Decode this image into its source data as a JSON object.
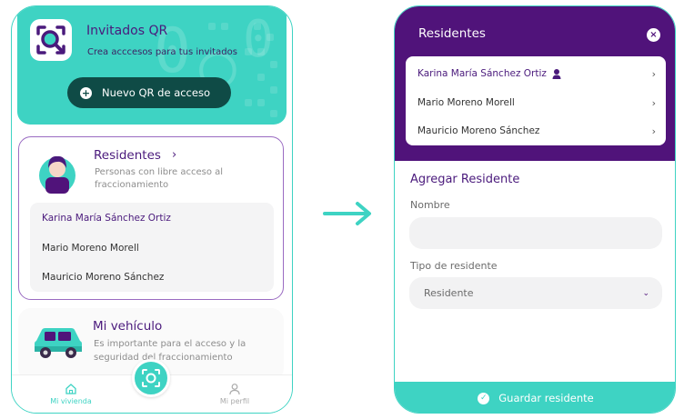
{
  "left_screen": {
    "qr_card": {
      "title": "Invitados QR",
      "subtitle": "Crea acccesos para tus invitados",
      "button_label": "Nuevo QR de acceso",
      "button_icon": "plus-circle-icon"
    },
    "residents_card": {
      "title": "Residentes",
      "title_chevron": "›",
      "description": "Personas con libre acceso al fraccionamiento",
      "list": [
        {
          "name": "Karina María Sánchez Ortiz"
        },
        {
          "name": "Mario Moreno Morell"
        },
        {
          "name": "Mauricio Moreno Sánchez"
        }
      ]
    },
    "vehicle_card": {
      "title": "Mi vehículo",
      "description": "Es importante para el acceso y la seguridad del fraccionamiento"
    },
    "bottom_nav": {
      "home_label": "Mi vivienda",
      "profile_label": "Mi perfil",
      "fab_icon": "qr-scan-icon"
    }
  },
  "right_screen": {
    "header": {
      "title": "Residentes",
      "close_glyph": "×"
    },
    "list": [
      {
        "name": "Karina María Sánchez Ortiz",
        "chevron": "›"
      },
      {
        "name": "Mario Moreno Morell",
        "chevron": "›"
      },
      {
        "name": "Mauricio Moreno Sánchez",
        "chevron": "›"
      }
    ],
    "form": {
      "title": "Agregar Residente",
      "name_label": "Nombre",
      "name_value": "",
      "type_label": "Tipo de residente",
      "type_value": "Residente",
      "type_chevron": "⌄"
    },
    "save_button": {
      "label": "Guardar residente",
      "check_glyph": "✓"
    }
  },
  "colors": {
    "teal": "#3ed3c3",
    "purple": "#50137a",
    "dark_teal": "#0f4b46"
  }
}
